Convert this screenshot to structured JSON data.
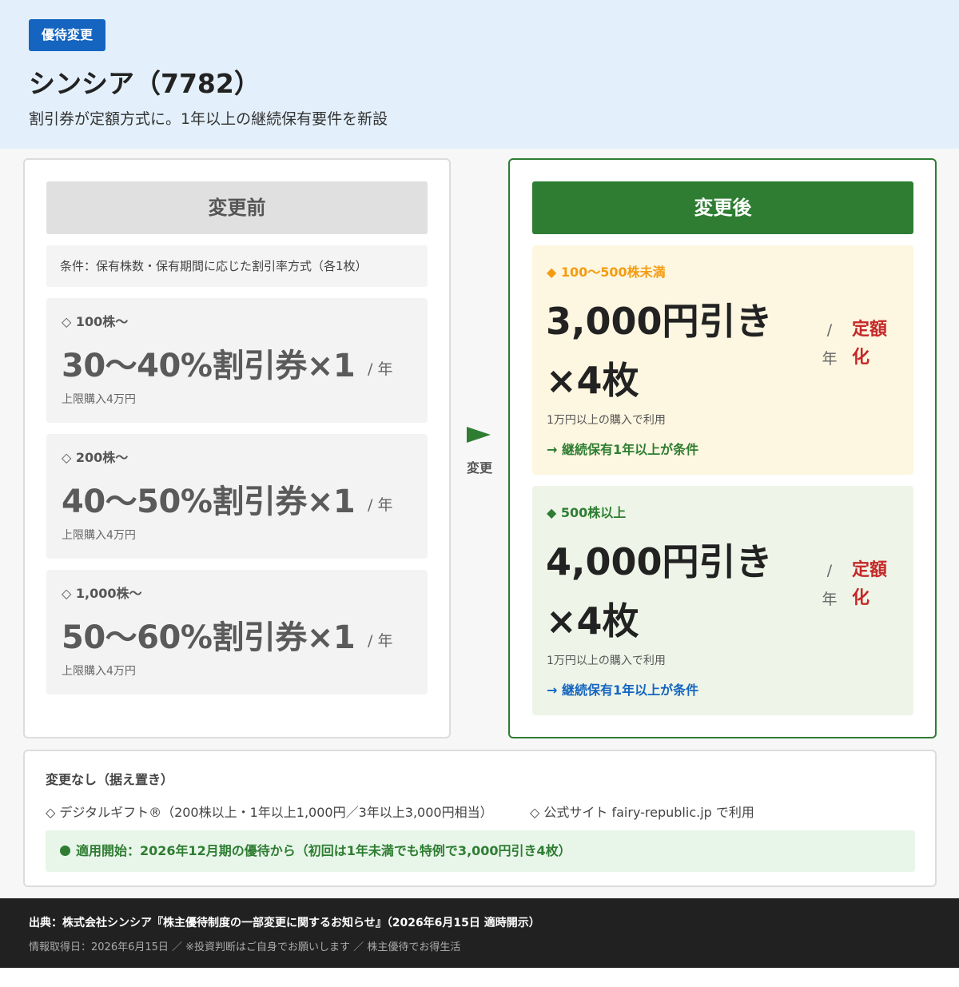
{
  "header": {
    "tag": "優待変更",
    "title": "シンシア（7782）",
    "subtitle": "割引券が定額方式に。1年以上の継続保有要件を新設"
  },
  "before": {
    "heading": "変更前",
    "condition": "条件：保有株数・保有期間に応じた割引率方式（各1枚）",
    "tiers": [
      {
        "label": "◇ 100株〜",
        "value": "30〜40%割引券×1",
        "unit": "/ 年",
        "note": "上限購入4万円"
      },
      {
        "label": "◇ 200株〜",
        "value": "40〜50%割引券×1",
        "unit": "/ 年",
        "note": "上限購入4万円"
      },
      {
        "label": "◇ 1,000株〜",
        "value": "50〜60%割引券×1",
        "unit": "/ 年",
        "note": "上限購入4万円"
      }
    ]
  },
  "arrow": {
    "label": "変更"
  },
  "after": {
    "heading": "変更後",
    "cards": [
      {
        "label": "◆ 100〜500株未満",
        "value_line1": "3,000円引き",
        "value_line2": "×4枚",
        "slash": "/",
        "year": "年",
        "fixed_line1": "定額",
        "fixed_line2": "化",
        "note": "1万円以上の購入で利用",
        "condition": "→ 継続保有1年以上が条件"
      },
      {
        "label": "◆ 500株以上",
        "value_line1": "4,000円引き",
        "value_line2": "×4枚",
        "slash": "/",
        "year": "年",
        "fixed_line1": "定額",
        "fixed_line2": "化",
        "note": "1万円以上の購入で利用",
        "condition": "→ 継続保有1年以上が条件"
      }
    ]
  },
  "no_change": {
    "title": "変更なし（据え置き）",
    "item1": "◇ デジタルギフト®（200株以上・1年以上1,000円／3年以上3,000円相当）",
    "item2": "◇ 公式サイト fairy-republic.jp で利用",
    "start": "適用開始：2026年12月期の優待から（初回は1年未満でも特例で3,000円引き4枚）"
  },
  "footer": {
    "source": "出典：株式会社シンシア『株主優待制度の一部変更に関するお知らせ』（2026年6月15日 適時開示）",
    "meta": "情報取得日：2026年6月15日 ／ ※投資判断はご自身でお願いします ／ 株主優待でお得生活"
  },
  "colors": {
    "tag_bg": "#1565c0",
    "header_bg": "#e3f0fb",
    "after_green": "#2e7d32",
    "fixed_red": "#c62828",
    "tier1_orange": "#f39c12",
    "footer_bg": "#212121"
  }
}
